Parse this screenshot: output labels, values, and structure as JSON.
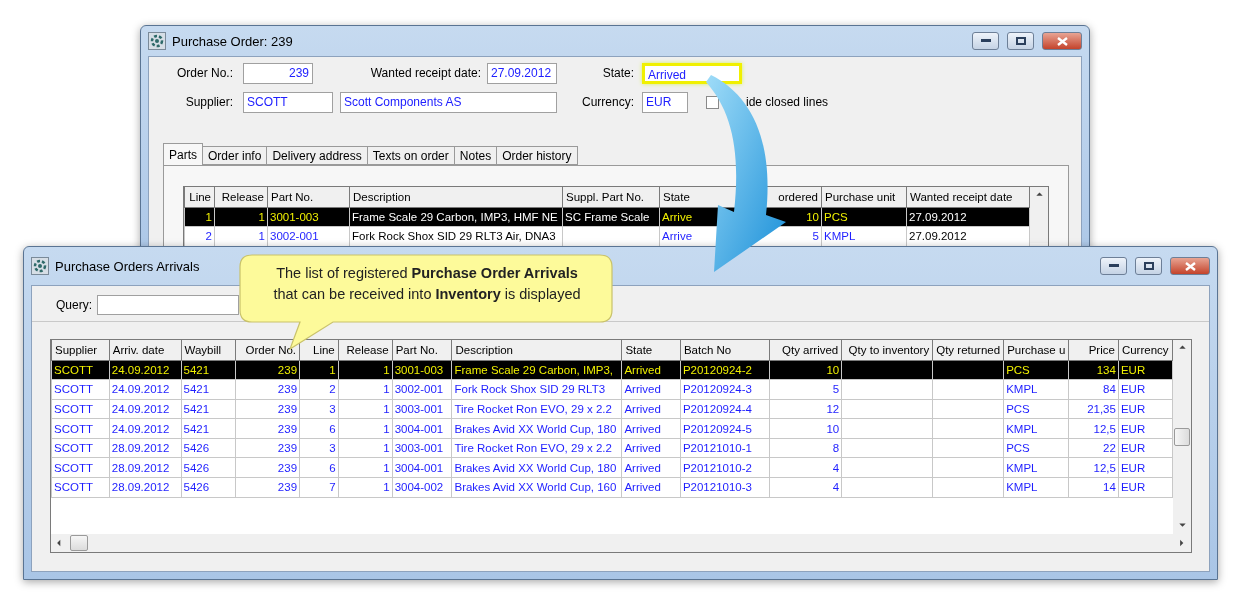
{
  "order_window": {
    "title": "Purchase Order: 239",
    "fields": [
      {
        "label": "Order No.:",
        "value": "239"
      },
      {
        "label": "Wanted receipt date:",
        "value": "27.09.2012"
      },
      {
        "label": "State:",
        "value": "Arrived",
        "highlighted": true
      },
      {
        "label": "Supplier:",
        "value": "SCOTT"
      },
      {
        "value": "Scott Components AS"
      },
      {
        "label": "Currency:",
        "value": "EUR"
      }
    ],
    "hide_closed_lines": {
      "label": "ide closed lines",
      "checked": false
    },
    "tabs": [
      {
        "label": "Parts",
        "selected": true
      },
      {
        "label": "Order info",
        "selected": false
      },
      {
        "label": "Delivery address",
        "selected": false
      },
      {
        "label": "Texts on order",
        "selected": false
      },
      {
        "label": "Notes",
        "selected": false
      },
      {
        "label": "Order history",
        "selected": false
      }
    ],
    "table": {
      "columns": [
        {
          "label": "Line",
          "kind": "number"
        },
        {
          "label": "Release",
          "kind": "number"
        },
        {
          "label": "Part No.",
          "kind": "code"
        },
        {
          "label": "Description",
          "kind": "text"
        },
        {
          "label": "Suppl. Part No.",
          "kind": "text"
        },
        {
          "label": "State",
          "kind": "code"
        },
        {
          "label": "ordered",
          "kind": "number"
        },
        {
          "label": "Purchase unit",
          "kind": "code"
        },
        {
          "label": "Wanted receipt date",
          "kind": "text"
        }
      ],
      "rows": [
        {
          "selected": true,
          "cells": [
            "1",
            "1",
            "3001-003",
            "Frame Scale 29 Carbon, IMP3, HMF NE",
            "SC Frame Scale",
            "Arrive",
            "10",
            "PCS",
            "27.09.2012"
          ]
        },
        {
          "selected": false,
          "cells": [
            "2",
            "1",
            "3002-001",
            "Fork Rock Shox SID 29 RLT3 Air, DNA3",
            null,
            "Arrive",
            "5",
            "KMPL",
            "27.09.2012"
          ]
        }
      ]
    }
  },
  "arrivals_window": {
    "title": "Purchase Orders Arrivals",
    "query": {
      "label": "Query:"
    },
    "table": {
      "columns": [
        {
          "label": "Supplier",
          "kind": "code"
        },
        {
          "label": "Arriv. date",
          "kind": "code"
        },
        {
          "label": "Waybill",
          "kind": "code"
        },
        {
          "label": "Order No.",
          "kind": "number"
        },
        {
          "label": "Line",
          "kind": "number"
        },
        {
          "label": "Release",
          "kind": "number"
        },
        {
          "label": "Part No.",
          "kind": "code"
        },
        {
          "label": "Description",
          "kind": "code"
        },
        {
          "label": "State",
          "kind": "code"
        },
        {
          "label": "Batch No",
          "kind": "code"
        },
        {
          "label": "Qty arrived",
          "kind": "number"
        },
        {
          "label": "Qty to inventory",
          "kind": "number"
        },
        {
          "label": "Qty returned",
          "kind": "number"
        },
        {
          "label": "Purchase u",
          "kind": "code"
        },
        {
          "label": "Price",
          "kind": "number"
        },
        {
          "label": "Currency",
          "kind": "code"
        }
      ],
      "rows": [
        {
          "selected": true,
          "cells": [
            "SCOTT",
            "24.09.2012",
            "5421",
            "239",
            "1",
            "1",
            "3001-003",
            "Frame Scale 29 Carbon, IMP3,",
            "Arrived",
            "P20120924-2",
            "10",
            null,
            null,
            "PCS",
            "134",
            "EUR"
          ]
        },
        {
          "selected": false,
          "cells": [
            "SCOTT",
            "24.09.2012",
            "5421",
            "239",
            "2",
            "1",
            "3002-001",
            "Fork Rock Shox SID 29 RLT3",
            "Arrived",
            "P20120924-3",
            "5",
            null,
            null,
            "KMPL",
            "84",
            "EUR"
          ]
        },
        {
          "selected": false,
          "cells": [
            "SCOTT",
            "24.09.2012",
            "5421",
            "239",
            "3",
            "1",
            "3003-001",
            "Tire Rocket Ron EVO, 29 x 2.2",
            "Arrived",
            "P20120924-4",
            "12",
            null,
            null,
            "PCS",
            "21,35",
            "EUR"
          ]
        },
        {
          "selected": false,
          "cells": [
            "SCOTT",
            "24.09.2012",
            "5421",
            "239",
            "6",
            "1",
            "3004-001",
            "Brakes Avid XX World Cup, 180",
            "Arrived",
            "P20120924-5",
            "10",
            null,
            null,
            "KMPL",
            "12,5",
            "EUR"
          ]
        },
        {
          "selected": false,
          "cells": [
            "SCOTT",
            "28.09.2012",
            "5426",
            "239",
            "3",
            "1",
            "3003-001",
            "Tire Rocket Ron EVO, 29 x 2.2",
            "Arrived",
            "P20121010-1",
            "8",
            null,
            null,
            "PCS",
            "22",
            "EUR"
          ]
        },
        {
          "selected": false,
          "cells": [
            "SCOTT",
            "28.09.2012",
            "5426",
            "239",
            "6",
            "1",
            "3004-001",
            "Brakes Avid XX World Cup, 180",
            "Arrived",
            "P20121010-2",
            "4",
            null,
            null,
            "KMPL",
            "12,5",
            "EUR"
          ]
        },
        {
          "selected": false,
          "cells": [
            "SCOTT",
            "28.09.2012",
            "5426",
            "239",
            "7",
            "1",
            "3004-002",
            "Brakes Avid XX World Cup, 160",
            "Arrived",
            "P20121010-3",
            "4",
            null,
            null,
            "KMPL",
            "14",
            "EUR"
          ]
        }
      ]
    }
  },
  "callout": {
    "lines": [
      "The list of registered **Purchase Order Arrivals**",
      "that can be received into **Inventory** is displayed"
    ]
  }
}
